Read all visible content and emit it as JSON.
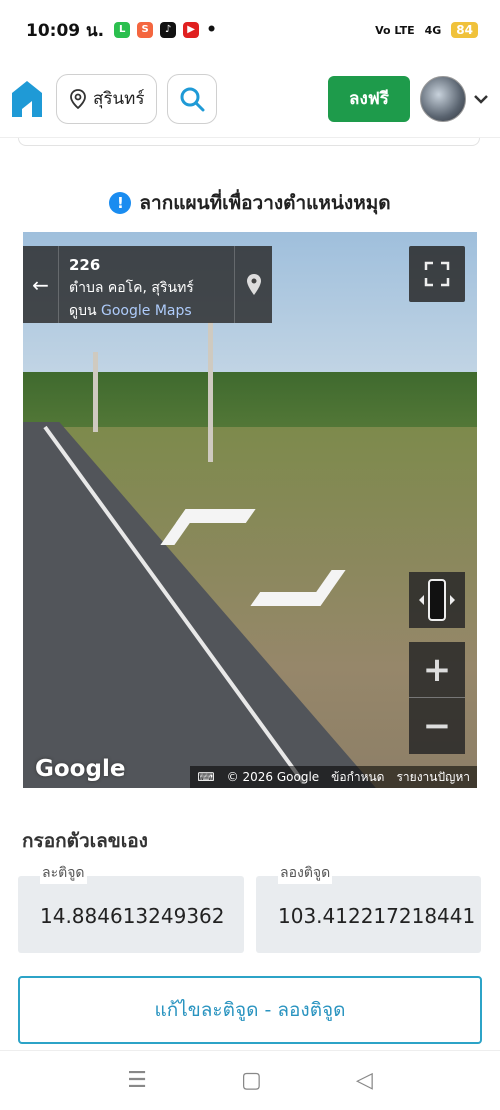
{
  "status_bar": {
    "time": "10:09 น.",
    "network": "Vo LTE",
    "signal": "4G",
    "battery": "84"
  },
  "header": {
    "location_label": "สุรินทร์",
    "free_button_label": "ลงฟรี"
  },
  "map_section": {
    "hint_text": "ลากแผนที่เพื่อวางตำแหน่งหมุด",
    "streetview": {
      "road_number": "226",
      "address": "ตำบล คอโค, สุรินทร์",
      "view_on_prefix": "ดูบน",
      "view_on_link": "Google Maps"
    },
    "google_logo": "Google",
    "attribution": {
      "copyright": "© 2026 Google",
      "terms": "ข้อกำหนด",
      "report": "รายงานปัญหา"
    }
  },
  "manual_entry": {
    "title": "กรอกตัวเลขเอง",
    "latitude_label": "ละติจูด",
    "latitude_value": "14.884613249362",
    "longitude_label": "ลองติจูด",
    "longitude_value": "103.412217218441",
    "edit_button_label": "แก้ไขละติจูด - ลองติจูด"
  }
}
